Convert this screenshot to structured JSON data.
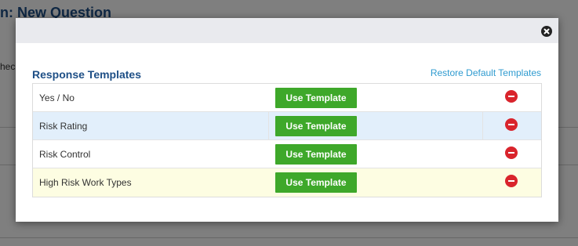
{
  "background": {
    "title": "n: New Question",
    "side_text": "hec"
  },
  "modal": {
    "section_title": "Response Templates",
    "restore_link": "Restore Default Templates",
    "use_label": "Use Template",
    "templates": [
      {
        "name": "Yes / No"
      },
      {
        "name": "Risk Rating"
      },
      {
        "name": "Risk Control"
      },
      {
        "name": "High Risk Work Types"
      }
    ]
  },
  "colors": {
    "accent_title": "#1e4f86",
    "link": "#2f9bd0",
    "use_button": "#3ea82a",
    "remove_icon": "#d9242c",
    "row_highlight_blue": "#e2effb",
    "row_highlight_yellow": "#fdfde2"
  },
  "icons": {
    "close": "close-circle-icon",
    "remove": "remove-circle-icon"
  }
}
